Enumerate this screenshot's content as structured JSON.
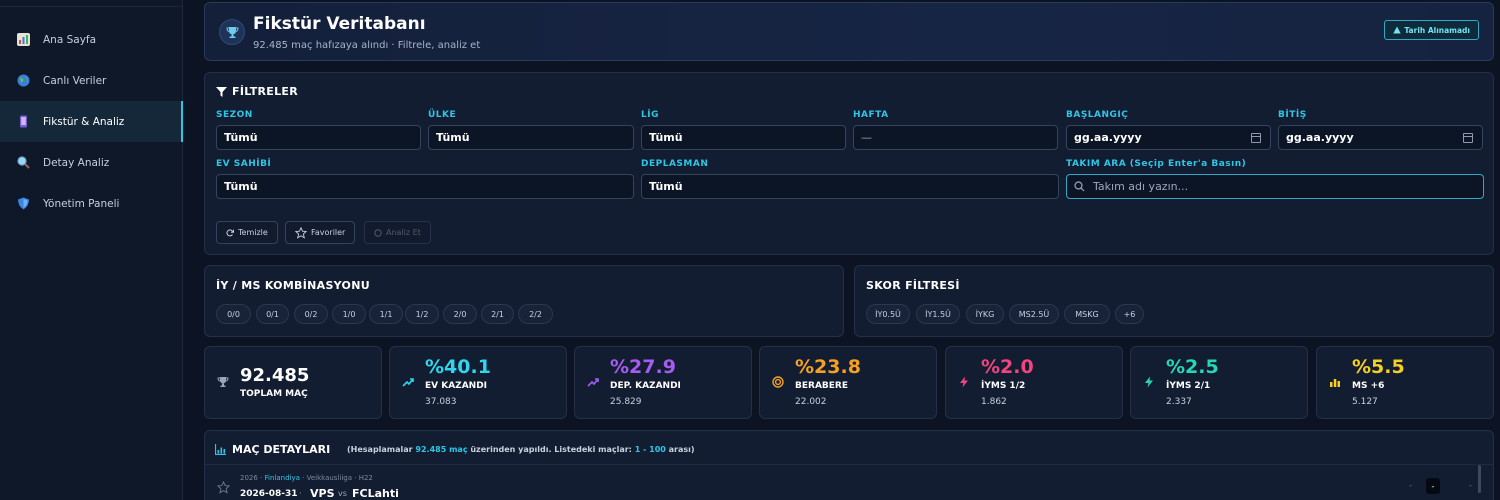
{
  "sidebar": {
    "items": [
      {
        "label": "Ana Sayfa",
        "icon": "bar-chart-icon"
      },
      {
        "label": "Canlı Veriler",
        "icon": "globe-icon"
      },
      {
        "label": "Fikstür & Analiz",
        "icon": "phone-icon",
        "active": true
      },
      {
        "label": "Detay Analiz",
        "icon": "magnifier-icon"
      },
      {
        "label": "Yönetim Paneli",
        "icon": "shield-icon"
      }
    ]
  },
  "header": {
    "title": "Fikstür Veritabanı",
    "subtitle": "92.485 maç hafızaya alındı · Filtrele, analiz et",
    "date_button": "Tarih Alınamadı"
  },
  "filters": {
    "title": "FİLTRELER",
    "fields": {
      "sezon": {
        "label": "SEZON",
        "value": "Tümü"
      },
      "ulke": {
        "label": "ÜLKE",
        "value": "Tümü"
      },
      "lig": {
        "label": "LİG",
        "value": "Tümü"
      },
      "hafta": {
        "label": "HAFTA",
        "value": "—"
      },
      "baslangic": {
        "label": "BAŞLANGIÇ",
        "value": "gg.aa.yyyy"
      },
      "bitis": {
        "label": "BİTİŞ",
        "value": "gg.aa.yyyy"
      },
      "ev_sahibi": {
        "label": "EV SAHİBİ",
        "value": "Tümü"
      },
      "deplasman": {
        "label": "DEPLASMAN",
        "value": "Tümü"
      },
      "takim_ara": {
        "label": "TAKIM ARA (Seçip Enter'a Basın)",
        "placeholder": "Takım adı yazın..."
      }
    },
    "buttons": {
      "clear": "Temizle",
      "favorites": "Favoriler",
      "analyze": "Analiz Et"
    }
  },
  "combo": {
    "title": "İY / MS KOMBİNASYONU",
    "chips": [
      "0/0",
      "0/1",
      "0/2",
      "1/0",
      "1/1",
      "1/2",
      "2/0",
      "2/1",
      "2/2"
    ]
  },
  "score_filter": {
    "title": "SKOR FİLTRESİ",
    "chips": [
      "İY0.5Ü",
      "İY1.5Ü",
      "İYKG",
      "MS2.5Ü",
      "MSKG",
      "+6"
    ]
  },
  "stats": [
    {
      "value": "92.485",
      "label": "TOPLAM MAÇ",
      "count": "",
      "color": "#ffffff",
      "icon": "trophy-icon"
    },
    {
      "value": "%40.1",
      "label": "EV KAZANDI",
      "count": "37.083",
      "color": "#2fd6f0",
      "icon": "trend-up-icon"
    },
    {
      "value": "%27.9",
      "label": "DEP. KAZANDI",
      "count": "25.829",
      "color": "#a65bf2",
      "icon": "trend-up-icon"
    },
    {
      "value": "%23.8",
      "label": "BERABERE",
      "count": "22.002",
      "color": "#f5a020",
      "icon": "target-icon"
    },
    {
      "value": "%2.0",
      "label": "İYMS 1/2",
      "count": "1.862",
      "color": "#f0457f",
      "icon": "bolt-icon"
    },
    {
      "value": "%2.5",
      "label": "İYMS 2/1",
      "count": "2.337",
      "color": "#27d6b8",
      "icon": "bolt-icon"
    },
    {
      "value": "%5.5",
      "label": "MS +6",
      "count": "5.127",
      "color": "#f5d020",
      "icon": "bar-chart-icon"
    }
  ],
  "match_details": {
    "title": "MAÇ DETAYLARI",
    "note_prefix": "(Hesaplamalar",
    "note_count": "92.485 maç",
    "note_mid": "üzerinden yapıldı. Listedeki maçlar:",
    "note_range": "1 - 100",
    "note_suffix": "arası)",
    "row": {
      "season": "2026",
      "country": "Finlandiya",
      "league": "Veikkausliiga",
      "week": "H22",
      "date": "2026-08-31",
      "home": "VPS",
      "vs": "vs",
      "away": "FCLahti",
      "score": "-"
    }
  }
}
